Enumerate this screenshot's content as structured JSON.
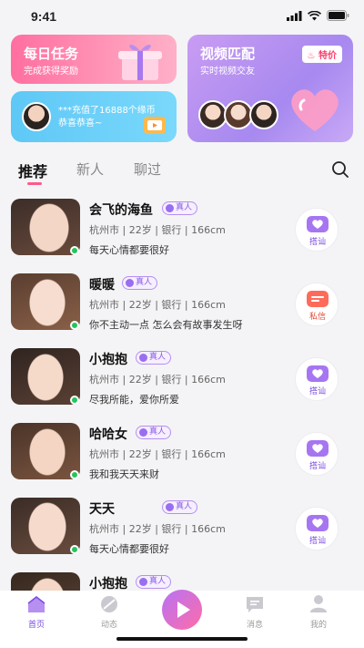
{
  "status_bar": {
    "time": "9:41"
  },
  "cards": {
    "task": {
      "title": "每日任务",
      "subtitle": "完成获得奖励"
    },
    "recharge": {
      "line1": "***充值了16888个缘币",
      "line2": "恭喜恭喜~"
    },
    "match": {
      "title": "视频匹配",
      "subtitle": "实时视频交友",
      "price_label": "特价"
    }
  },
  "tabs": [
    {
      "label": "推荐",
      "active": true
    },
    {
      "label": "新人",
      "active": false
    },
    {
      "label": "聊过",
      "active": false
    }
  ],
  "badge_label": "真人",
  "users": [
    {
      "name": "会飞的海鱼",
      "info": "杭州市 | 22岁 | 银行 | 166cm",
      "bio": "每天心情都要很好",
      "action": "搭讪",
      "verified": true
    },
    {
      "name": "暖暖",
      "info": "杭州市 | 22岁 | 银行 | 166cm",
      "bio": "你不主动一点 怎么会有故事发生呀",
      "action": "私信",
      "verified": true
    },
    {
      "name": "小抱抱",
      "info": "杭州市 | 22岁 | 银行 | 166cm",
      "bio": "尽我所能，爱你所爱",
      "action": "搭讪",
      "verified": true
    },
    {
      "name": "哈哈女",
      "info": "杭州市 | 22岁 | 银行 | 166cm",
      "bio": "我和我天天来财",
      "action": "搭讪",
      "verified": true
    },
    {
      "name": "天天",
      "info": "杭州市 | 22岁 | 银行 | 166cm",
      "bio": "每天心情都要很好",
      "action": "搭讪",
      "verified": true
    },
    {
      "name": "小抱抱",
      "info": "",
      "bio": "",
      "action": "",
      "verified": true
    }
  ],
  "bottom_nav": [
    {
      "label": "首页",
      "active": true
    },
    {
      "label": "动态",
      "active": false
    },
    {
      "label": "",
      "active": false
    },
    {
      "label": "消息",
      "active": false
    },
    {
      "label": "我的",
      "active": false
    }
  ],
  "colors": {
    "accent": "#7a4be0",
    "pink": "#ff5a8a",
    "online": "#22c55e"
  }
}
